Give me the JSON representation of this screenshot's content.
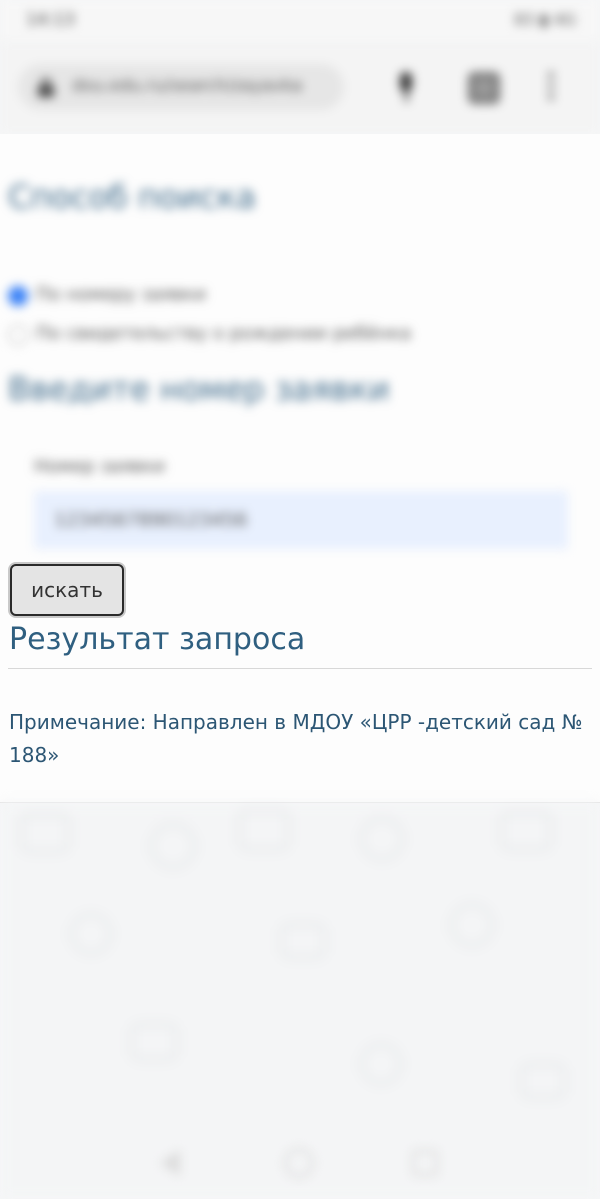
{
  "status_bar": {
    "time": "14:13",
    "indicators": "83 ▮ 4G"
  },
  "browser": {
    "url": "dou.edu.ru/search/zayavka",
    "icons": [
      "lock-icon",
      "mic-icon",
      "tabs-icon",
      "menu-icon"
    ]
  },
  "search_method": {
    "heading": "Способ поиска",
    "options": [
      {
        "label": "По номеру заявки",
        "selected": true
      },
      {
        "label": "По свидетельству о рождении ребёнка",
        "selected": false
      }
    ]
  },
  "application_number": {
    "heading": "Введите номер заявки",
    "field_label": "Номер заявки",
    "value": "1234567890123456"
  },
  "search_button": {
    "label": "искать"
  },
  "result": {
    "heading": "Результат запроса",
    "note": "Примечание: Направлен в МДОУ «ЦРР -детский сад № 188»"
  },
  "colors": {
    "heading": "#3e6a8a",
    "result_text": "#2c5674",
    "radio_selected": "#3b82f6",
    "input_bg": "#e8f0fe"
  }
}
